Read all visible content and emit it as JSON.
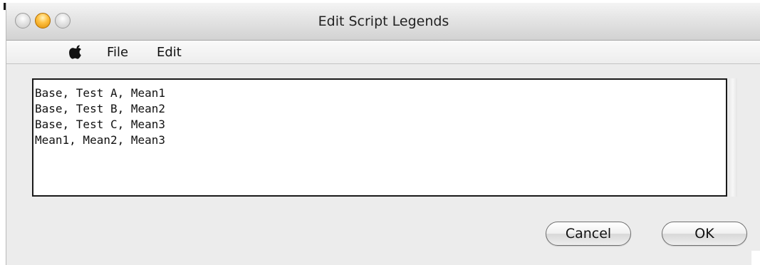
{
  "window": {
    "title": "Edit Script Legends"
  },
  "titlebar": {
    "buttons": [
      "close",
      "minimize",
      "zoom"
    ]
  },
  "menubar": {
    "apple_icon": "apple-icon",
    "items": [
      "File",
      "Edit"
    ]
  },
  "script": {
    "lines": [
      "Base, Test A, Mean1",
      "Base, Test B, Mean2",
      "Base, Test C, Mean3",
      "Mean1, Mean2, Mean3"
    ]
  },
  "buttons": {
    "cancel": "Cancel",
    "ok": "OK"
  },
  "colors": {
    "minimize": "#ffc245",
    "window_bg": "#ececec"
  }
}
